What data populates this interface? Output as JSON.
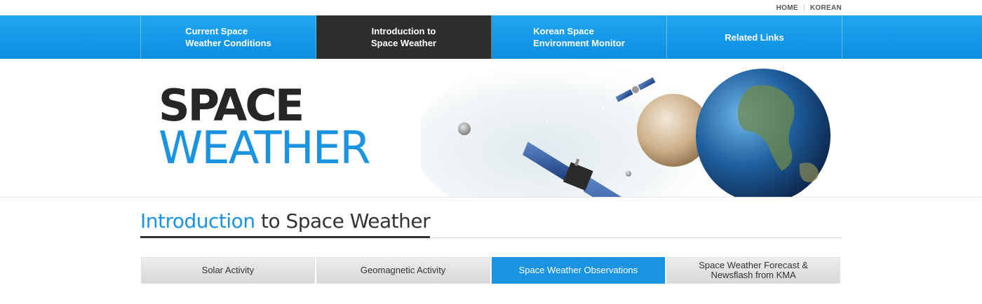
{
  "utility": {
    "home": "HOME",
    "korean": "KOREAN"
  },
  "nav": {
    "items": [
      {
        "label": "Current Space\nWeather Conditions",
        "active": false
      },
      {
        "label": "Introduction to\nSpace Weather",
        "active": true
      },
      {
        "label": "Korean Space\nEnvironment Monitor",
        "active": false
      },
      {
        "label": "Related Links",
        "active": false
      }
    ]
  },
  "banner": {
    "line1": "SPACE",
    "line2": "WEATHER"
  },
  "page_title": {
    "highlight": "Introduction",
    "rest": " to Space Weather"
  },
  "tabs": [
    {
      "label": "Solar Activity",
      "active": false
    },
    {
      "label": "Geomagnetic Activity",
      "active": false
    },
    {
      "label": "Space Weather Observations",
      "active": true
    },
    {
      "label": "Space Weather Forecast &\nNewsflash from KMA",
      "active": false
    }
  ],
  "colors": {
    "accent": "#1a93e0",
    "nav_bg": "#1fa6f2",
    "nav_active": "#2e2e2e",
    "tab_bg": "#e2e2e2"
  }
}
